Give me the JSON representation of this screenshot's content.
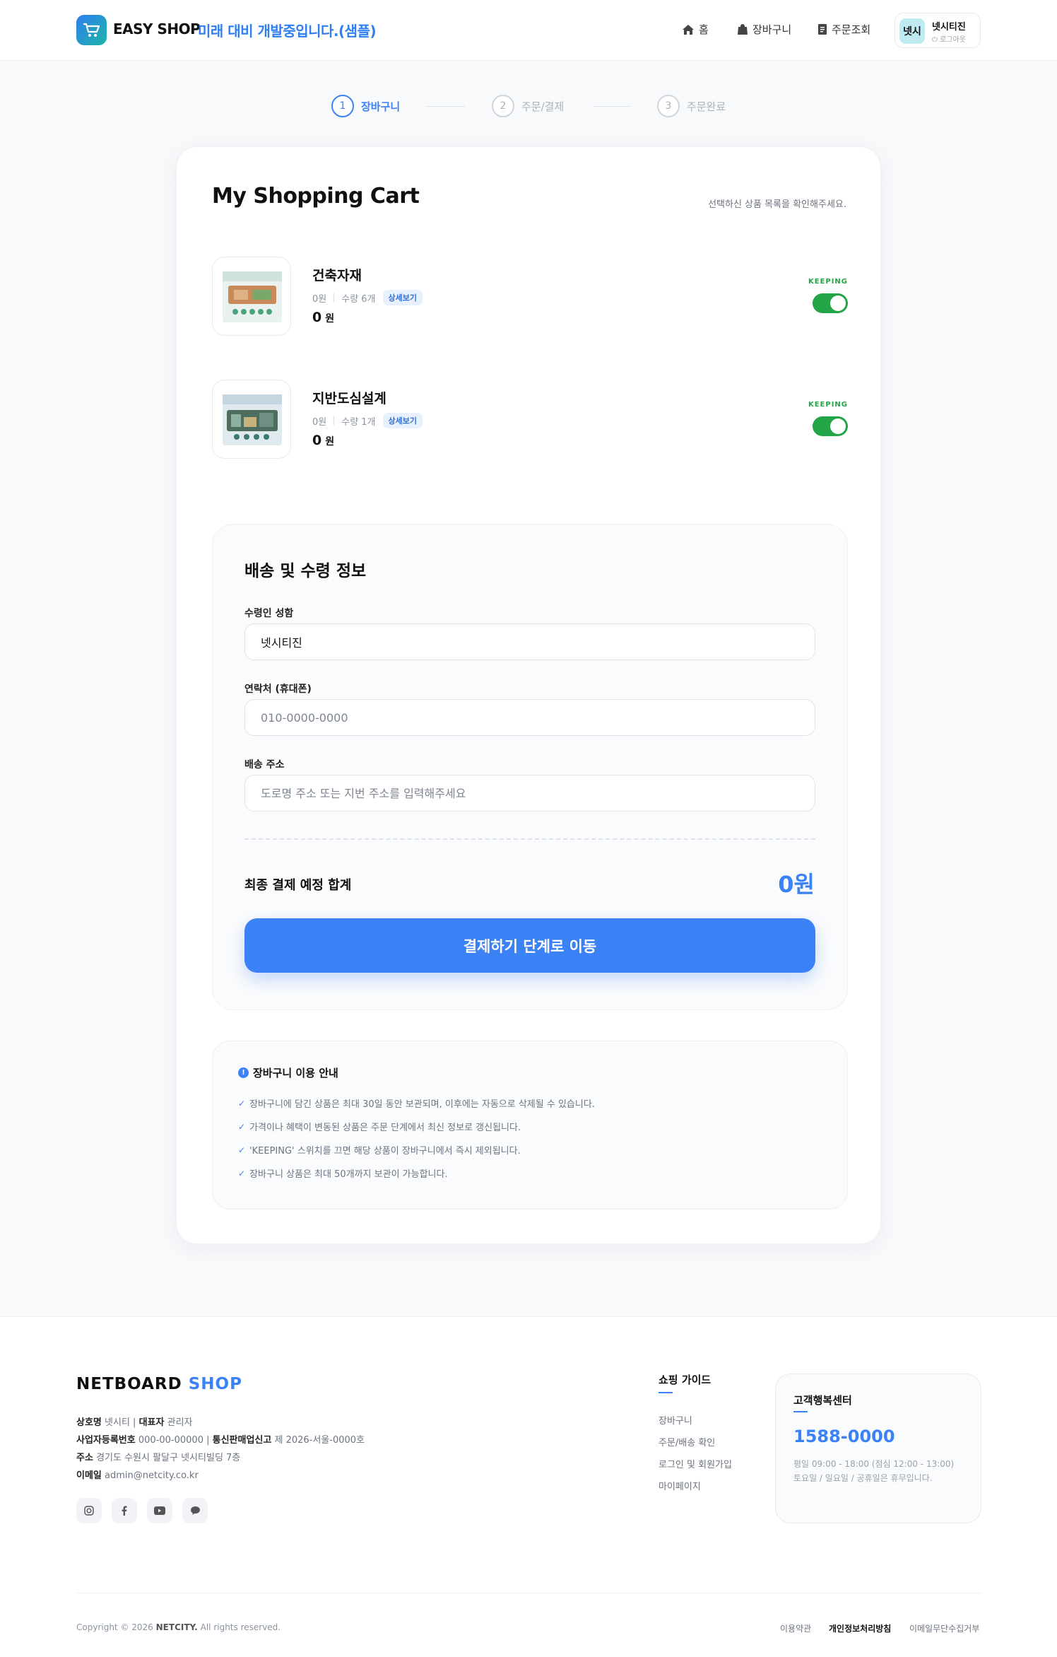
{
  "header": {
    "brand": "EASY SHOP",
    "tagline": "미래 대비 개발중입니다.(샘플)",
    "nav": {
      "home": "홈",
      "cart": "장바구니",
      "orders": "주문조회"
    },
    "user": {
      "avatar": "넷시",
      "name": "넷시티진",
      "logout": "로그아웃"
    }
  },
  "steps": [
    {
      "num": "1",
      "label": "장바구니"
    },
    {
      "num": "2",
      "label": "주문/결제"
    },
    {
      "num": "3",
      "label": "주문완료"
    }
  ],
  "cart": {
    "title": "My Shopping Cart",
    "subtitle": "선택하신 상품 목록을 확인해주세요.",
    "items": [
      {
        "name": "건축자재",
        "price_small": "0원",
        "qty": "수량 6개",
        "detail": "상세보기",
        "price": "0",
        "unit": "원",
        "keep": "KEEPING"
      },
      {
        "name": "지반도심설계",
        "price_small": "0원",
        "qty": "수량 1개",
        "detail": "상세보기",
        "price": "0",
        "unit": "원",
        "keep": "KEEPING"
      }
    ]
  },
  "shipping": {
    "title": "배송 및 수령 정보",
    "name_label": "수령인 성함",
    "name_value": "넷시티진",
    "phone_label": "연락처 (휴대폰)",
    "phone_placeholder": "010-0000-0000",
    "addr_label": "배송 주소",
    "addr_placeholder": "도로명 주소 또는 지번 주소를 입력해주세요",
    "total_label": "최종 결제 예정 합계",
    "total_value": "0원",
    "pay_button": "결제하기 단계로 이동"
  },
  "notice": {
    "title": "장바구니 이용 안내",
    "lines": [
      "장바구니에 담긴 상품은 최대 30일 동안 보관되며, 이후에는 자동으로 삭제될 수 있습니다.",
      "가격이나 혜택이 변동된 상품은 주문 단계에서 최신 정보로 갱신됩니다.",
      "'KEEPING' 스위치를 끄면 해당 상품이 장바구니에서 즉시 제외됩니다.",
      "장바구니 상품은 최대 50개까지 보관이 가능합니다."
    ]
  },
  "footer": {
    "brand_a": "NETBOARD",
    "brand_b": "SHOP",
    "company_label": "상호명",
    "company": "넷시티",
    "ceo_label": "대표자",
    "ceo": "관리자",
    "bizno_label": "사업자등록번호",
    "bizno": "000-00-00000",
    "commerce_label": "통신판매업신고",
    "commerce": "제 2026-서울-0000호",
    "addr_label": "주소",
    "addr": "경기도 수원시 팔달구 넷시티빌딩 7층",
    "email_label": "이메일",
    "email": "admin@netcity.co.kr",
    "guide_title": "쇼핑 가이드",
    "guide_links": [
      "장바구니",
      "주문/배송 확인",
      "로그인 및 회원가입",
      "마이페이지"
    ],
    "cs_title": "고객행복센터",
    "cs_phone": "1588-0000",
    "cs_hours": "평일 09:00 - 18:00 (점심 12:00 - 13:00)",
    "cs_holiday": "토요일 / 일요일 / 공휴일은 휴무입니다.",
    "copyright_pre": "Copyright © 2026",
    "copyright_brand": "NETCITY.",
    "copyright_post": "All rights reserved.",
    "links": [
      "이용약관",
      "개인정보처리방침",
      "이메일무단수집거부"
    ]
  }
}
